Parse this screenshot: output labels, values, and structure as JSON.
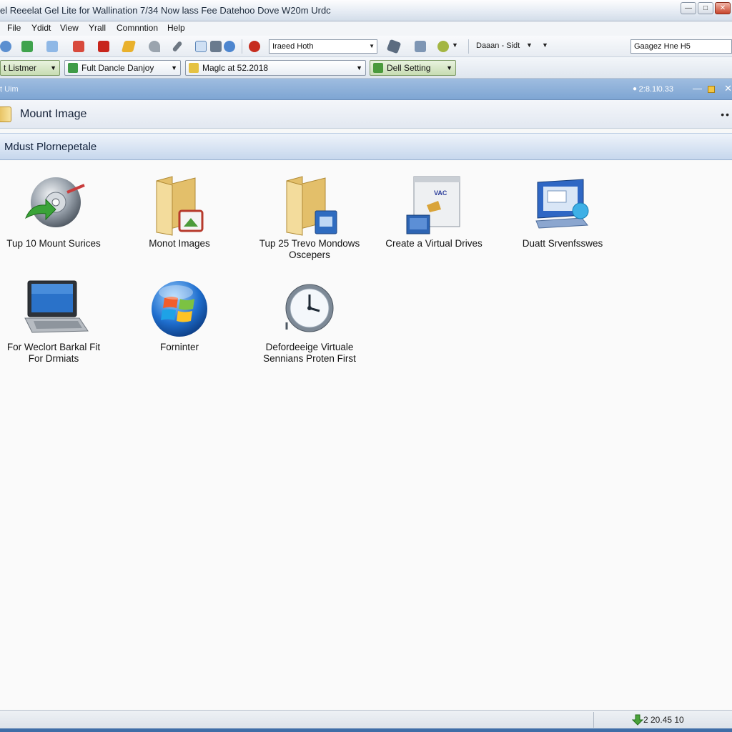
{
  "window": {
    "title": "el Reeelat Gel Lite for Wallination 7/34 Now lass Fee Datehoo Dove W20m Urdc",
    "minimize_icon": "minimize-icon",
    "maximize_icon": "maximize-icon",
    "close_icon": "close-icon"
  },
  "menu": {
    "items": [
      "File",
      "Ydidt",
      "View",
      "Yrall",
      "Comnntion",
      "Help"
    ]
  },
  "toolbar1": {
    "select_value": "Iraeed Hoth",
    "view_label": "Daaan - Sidt",
    "search_value": "Gaagez Hne H5"
  },
  "toolbar2": {
    "combo1": "t Listmer",
    "combo2": "Fult Dancle Danjoy",
    "combo3": "Maglc at 52.2018",
    "combo4": "Dell Setting"
  },
  "infobar": {
    "left_text": "t Uim",
    "right_text": "2:8.1l0.33"
  },
  "page": {
    "title": "Mount Image",
    "section_title": "Mdust Plornepetale"
  },
  "items": [
    {
      "label": "Tup 10 Mount Surices",
      "icon": "disc-mount-icon"
    },
    {
      "label": "Monot Images",
      "icon": "folder-images-icon"
    },
    {
      "label": "Tup 25 Trevo Mondows Oscepers",
      "icon": "folder-windows-icon"
    },
    {
      "label": "Create a Virtual Drives",
      "icon": "virtual-drive-box-icon"
    },
    {
      "label": "Duatt Srvenfsswes",
      "icon": "computer-globe-icon"
    },
    {
      "label": "For Weclort Barkal Fit For Drmiats",
      "icon": "laptop-icon"
    },
    {
      "label": "Forninter",
      "icon": "windows-logo-icon"
    },
    {
      "label": "Defordeeige Virtuale Sennians Proten First",
      "icon": "clock-icon"
    }
  ],
  "status": {
    "text": "2 20.45   10"
  },
  "colors": {
    "accent": "#7ea5d3",
    "section": "#c6d7ed",
    "taskbar": "#3f6ea7"
  }
}
